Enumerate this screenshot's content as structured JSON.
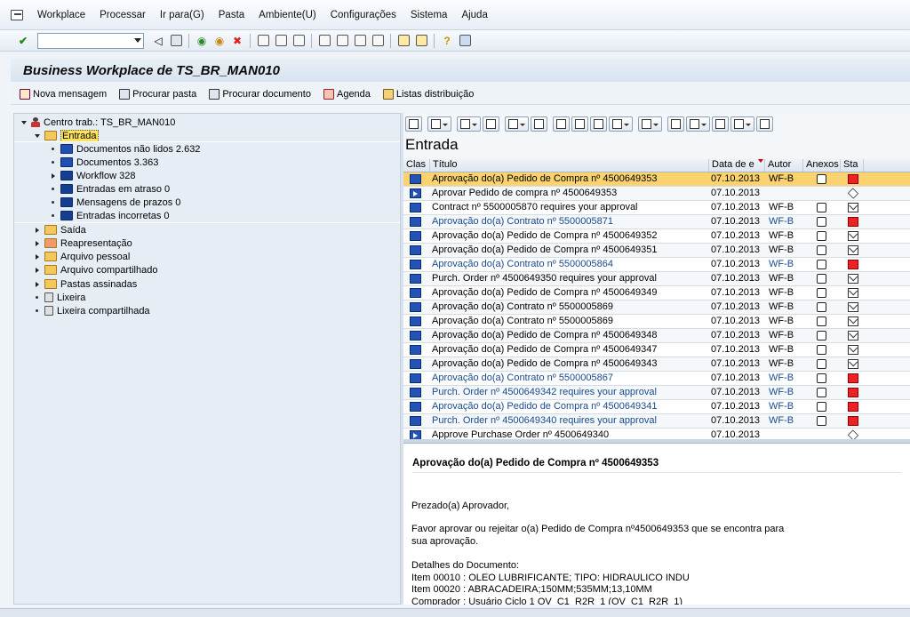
{
  "menu": {
    "items": [
      "Workplace",
      "Processar",
      "Ir para(G)",
      "Pasta",
      "Ambiente(U)",
      "Configurações",
      "Sistema",
      "Ajuda"
    ]
  },
  "toolbar": {
    "command_field_value": ""
  },
  "title": "Business Workplace de TS_BR_MAN010",
  "app_toolbar": {
    "new_message": "Nova mensagem",
    "find_folder": "Procurar pasta",
    "find_document": "Procurar documento",
    "agenda": "Agenda",
    "distribution_lists": "Listas distribuição"
  },
  "tree": {
    "root": "Centro trab.: TS_BR_MAN010",
    "inbox": "Entrada",
    "inbox_children": [
      "Documentos não lidos 2.632",
      "Documentos 3.363",
      "Workflow 328",
      "Entradas em atraso 0",
      "Mensagens de prazos 0",
      "Entradas incorretas 0"
    ],
    "folders": [
      "Saída",
      "Reapresentação",
      "Arquivo pessoal",
      "Arquivo compartilhado",
      "Pastas assinadas",
      "Lixeira",
      "Lixeira compartilhada"
    ]
  },
  "grid": {
    "heading": "Entrada",
    "columns": [
      "Clas",
      "Título",
      "Data de e",
      "Autor",
      "Anexos",
      "Sta"
    ],
    "rows": [
      {
        "title": "Aprovação do(a) Pedido de Compra nº 4500649353",
        "date": "07.10.2013",
        "author": "WF-B",
        "cls": "doc",
        "attach": true,
        "status": "urgent",
        "style": "sel"
      },
      {
        "title": "Aprovar Pedido de compra nº 4500649353",
        "date": "07.10.2013",
        "author": "",
        "cls": "wf",
        "attach": false,
        "status": "box",
        "style": ""
      },
      {
        "title": "Contract nº 5500005870 requires your approval",
        "date": "07.10.2013",
        "author": "WF-B",
        "cls": "doc",
        "attach": true,
        "status": "env",
        "style": ""
      },
      {
        "title": "Aprovação do(a) Contrato nº 5500005871",
        "date": "07.10.2013",
        "author": "WF-B",
        "cls": "doc",
        "attach": true,
        "status": "urgent",
        "style": "link"
      },
      {
        "title": "Aprovação do(a) Pedido de Compra nº 4500649352",
        "date": "07.10.2013",
        "author": "WF-B",
        "cls": "doc",
        "attach": true,
        "status": "env",
        "style": ""
      },
      {
        "title": "Aprovação do(a) Pedido de Compra nº 4500649351",
        "date": "07.10.2013",
        "author": "WF-B",
        "cls": "doc",
        "attach": true,
        "status": "env",
        "style": ""
      },
      {
        "title": "Aprovação do(a) Contrato nº 5500005864",
        "date": "07.10.2013",
        "author": "WF-B",
        "cls": "doc",
        "attach": true,
        "status": "urgent",
        "style": "link"
      },
      {
        "title": "Purch. Order nº 4500649350 requires your approval",
        "date": "07.10.2013",
        "author": "WF-B",
        "cls": "doc",
        "attach": true,
        "status": "env",
        "style": ""
      },
      {
        "title": "Aprovação do(a) Pedido de Compra nº 4500649349",
        "date": "07.10.2013",
        "author": "WF-B",
        "cls": "doc",
        "attach": true,
        "status": "env",
        "style": ""
      },
      {
        "title": "Aprovação do(a) Contrato nº 5500005869",
        "date": "07.10.2013",
        "author": "WF-B",
        "cls": "doc",
        "attach": true,
        "status": "env",
        "style": ""
      },
      {
        "title": "Aprovação do(a) Contrato nº 5500005869",
        "date": "07.10.2013",
        "author": "WF-B",
        "cls": "doc",
        "attach": true,
        "status": "env",
        "style": ""
      },
      {
        "title": "Aprovação do(a) Pedido de Compra nº 4500649348",
        "date": "07.10.2013",
        "author": "WF-B",
        "cls": "doc",
        "attach": true,
        "status": "env",
        "style": ""
      },
      {
        "title": "Aprovação do(a) Pedido de Compra nº 4500649347",
        "date": "07.10.2013",
        "author": "WF-B",
        "cls": "doc",
        "attach": true,
        "status": "env",
        "style": ""
      },
      {
        "title": "Aprovação do(a) Pedido de Compra nº 4500649343",
        "date": "07.10.2013",
        "author": "WF-B",
        "cls": "doc",
        "attach": true,
        "status": "env",
        "style": ""
      },
      {
        "title": "Aprovação do(a) Contrato nº 5500005867",
        "date": "07.10.2013",
        "author": "WF-B",
        "cls": "doc",
        "attach": true,
        "status": "urgent",
        "style": "link"
      },
      {
        "title": "Purch. Order nº 4500649342 requires your approval",
        "date": "07.10.2013",
        "author": "WF-B",
        "cls": "doc",
        "attach": true,
        "status": "urgent",
        "style": "link"
      },
      {
        "title": "Aprovação do(a) Pedido de Compra nº 4500649341",
        "date": "07.10.2013",
        "author": "WF-B",
        "cls": "doc",
        "attach": true,
        "status": "urgent",
        "style": "link"
      },
      {
        "title": "Purch. Order nº 4500649340 requires your approval",
        "date": "07.10.2013",
        "author": "WF-B",
        "cls": "doc",
        "attach": true,
        "status": "urgent",
        "style": "link"
      },
      {
        "title": "Approve Purchase Order nº 4500649340",
        "date": "07.10.2013",
        "author": "",
        "cls": "wf",
        "attach": false,
        "status": "box",
        "style": ""
      }
    ]
  },
  "preview": {
    "subject": "Aprovação do(a) Pedido de Compra nº 4500649353",
    "lines": [
      "Prezado(a) Aprovador,",
      "Favor aprovar ou rejeitar o(a) Pedido de Compra nº4500649353 que se encontra para",
      "sua aprovação.",
      "Detalhes do Documento:",
      "Item 00010 : OLEO LUBRIFICANTE; TIPO: HIDRAULICO INDU",
      "Item 00020 : ABRACADEIRA;150MM;535MM;13,10MM",
      "Comprador : Usuário Ciclo 1 OV_C1_R2R_1 (OV_C1_R2R_1)"
    ]
  },
  "colors": {
    "selected_row": "#fbd36e",
    "link_text": "#1a4a8a",
    "urgent": "#e22222",
    "tree_bg": "#e6edf5"
  }
}
